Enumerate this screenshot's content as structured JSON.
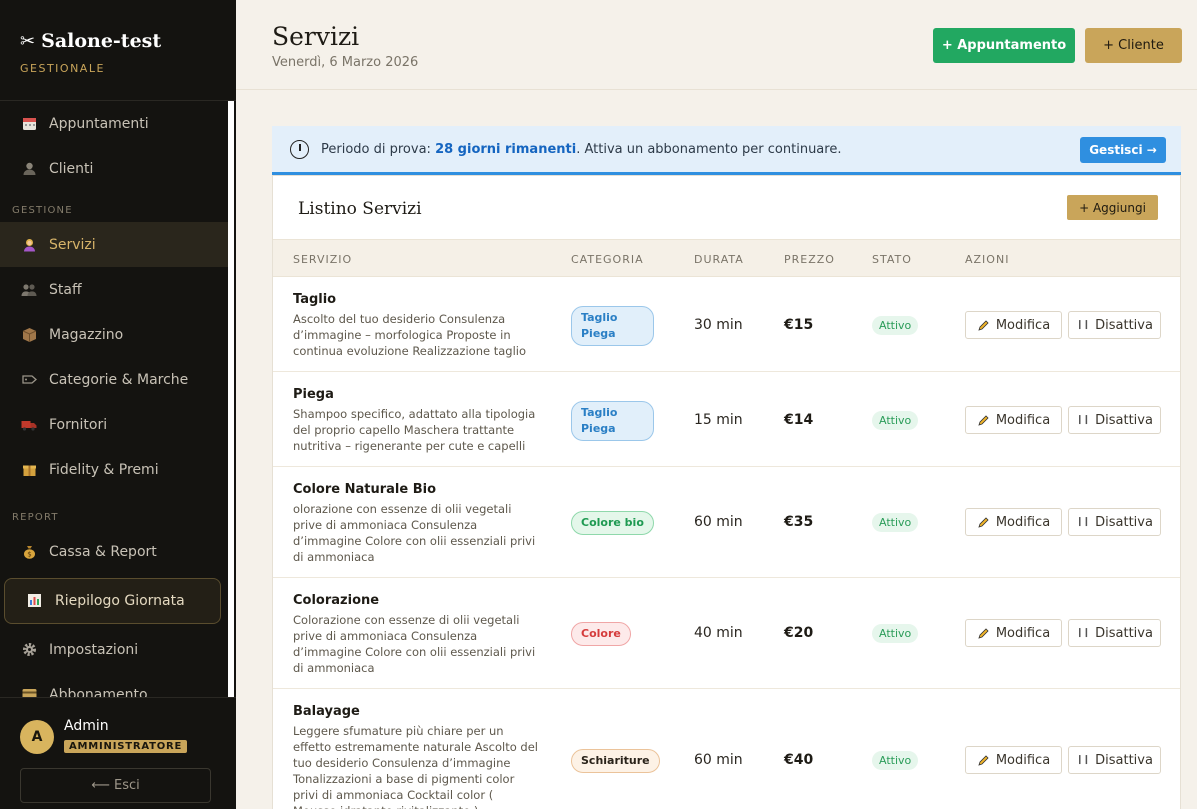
{
  "brand": {
    "title": "Salone-test",
    "subtitle": "GESTIONALE",
    "icon": "scissors-icon"
  },
  "nav": {
    "items_top": [
      {
        "label": "Appuntamenti",
        "icon": "calendar-icon"
      },
      {
        "label": "Clienti",
        "icon": "person-icon"
      }
    ],
    "section_gestione": "GESTIONE",
    "items_gestione": [
      {
        "label": "Servizi",
        "icon": "hairdresser-icon",
        "active": true
      },
      {
        "label": "Staff",
        "icon": "people-icon"
      },
      {
        "label": "Magazzino",
        "icon": "box-icon"
      },
      {
        "label": "Categorie & Marche",
        "icon": "tag-icon"
      },
      {
        "label": "Fornitori",
        "icon": "truck-icon"
      },
      {
        "label": "Fidelity & Premi",
        "icon": "gift-icon"
      }
    ],
    "section_report": "REPORT",
    "items_report": [
      {
        "label": "Cassa & Report",
        "icon": "money-bag-icon"
      },
      {
        "label": "Riepilogo Giornata",
        "icon": "bar-chart-icon"
      },
      {
        "label": "Impostazioni",
        "icon": "gear-icon"
      },
      {
        "label": "Abbonamento",
        "icon": "card-icon"
      }
    ]
  },
  "user": {
    "initial": "A",
    "name": "Admin",
    "role": "AMMINISTRATORE",
    "logout": "⟵ Esci"
  },
  "header": {
    "title": "Servizi",
    "date": "Venerdì, 6 Marzo 2026",
    "btn_appuntamento": "+ Appuntamento",
    "btn_cliente": "+ Cliente"
  },
  "banner": {
    "prefix": "Periodo di prova: ",
    "days": "28 giorni rimanenti",
    "suffix": ". Attiva un abbonamento per continuare.",
    "button": "Gestisci →"
  },
  "card": {
    "title": "Listino Servizi",
    "add_button": "+ Aggiungi",
    "columns": [
      "SERVIZIO",
      "CATEGORIA",
      "DURATA",
      "PREZZO",
      "STATO",
      "AZIONI"
    ],
    "rows": [
      {
        "name": "Taglio",
        "desc": "Ascolto del tuo desiderio Consulenza d’immagine – morfologica Proposte in continua evoluzione Realizzazione taglio",
        "category": "Taglio Piega",
        "duration": "30 min",
        "price": "€15",
        "status": "Attivo"
      },
      {
        "name": "Piega",
        "desc": "Shampoo specifico, adattato alla tipologia del proprio capello Maschera trattante nutritiva – rigenerante per cute e capelli",
        "category": "Taglio Piega",
        "duration": "15 min",
        "price": "€14",
        "status": "Attivo"
      },
      {
        "name": "Colore Naturale Bio",
        "desc": "olorazione con essenze di olii vegetali prive di ammoniaca Consulenza d’immagine Colore con olii essenziali privi di ammoniaca",
        "category": "Colore bio",
        "duration": "60 min",
        "price": "€35",
        "status": "Attivo"
      },
      {
        "name": "Colorazione",
        "desc": "Colorazione con essenze di olii vegetali prive di ammoniaca Consulenza d’immagine Colore con olii essenziali privi di ammoniaca",
        "category": "Colore",
        "duration": "40 min",
        "price": "€20",
        "status": "Attivo"
      },
      {
        "name": "Balayage",
        "desc": "Leggere sfumature più chiare per un effetto estremamente naturale Ascolto del tuo desiderio Consulenza d’immagine Tonalizzazioni a base di pigmenti color privi di ammoniaca Cocktail color ( Mousse idratante rivitalizzante )",
        "category": "Schiariture",
        "duration": "60 min",
        "price": "€40",
        "status": "Attivo"
      }
    ],
    "action_edit": "Modifica",
    "action_disable": "Disattiva"
  }
}
